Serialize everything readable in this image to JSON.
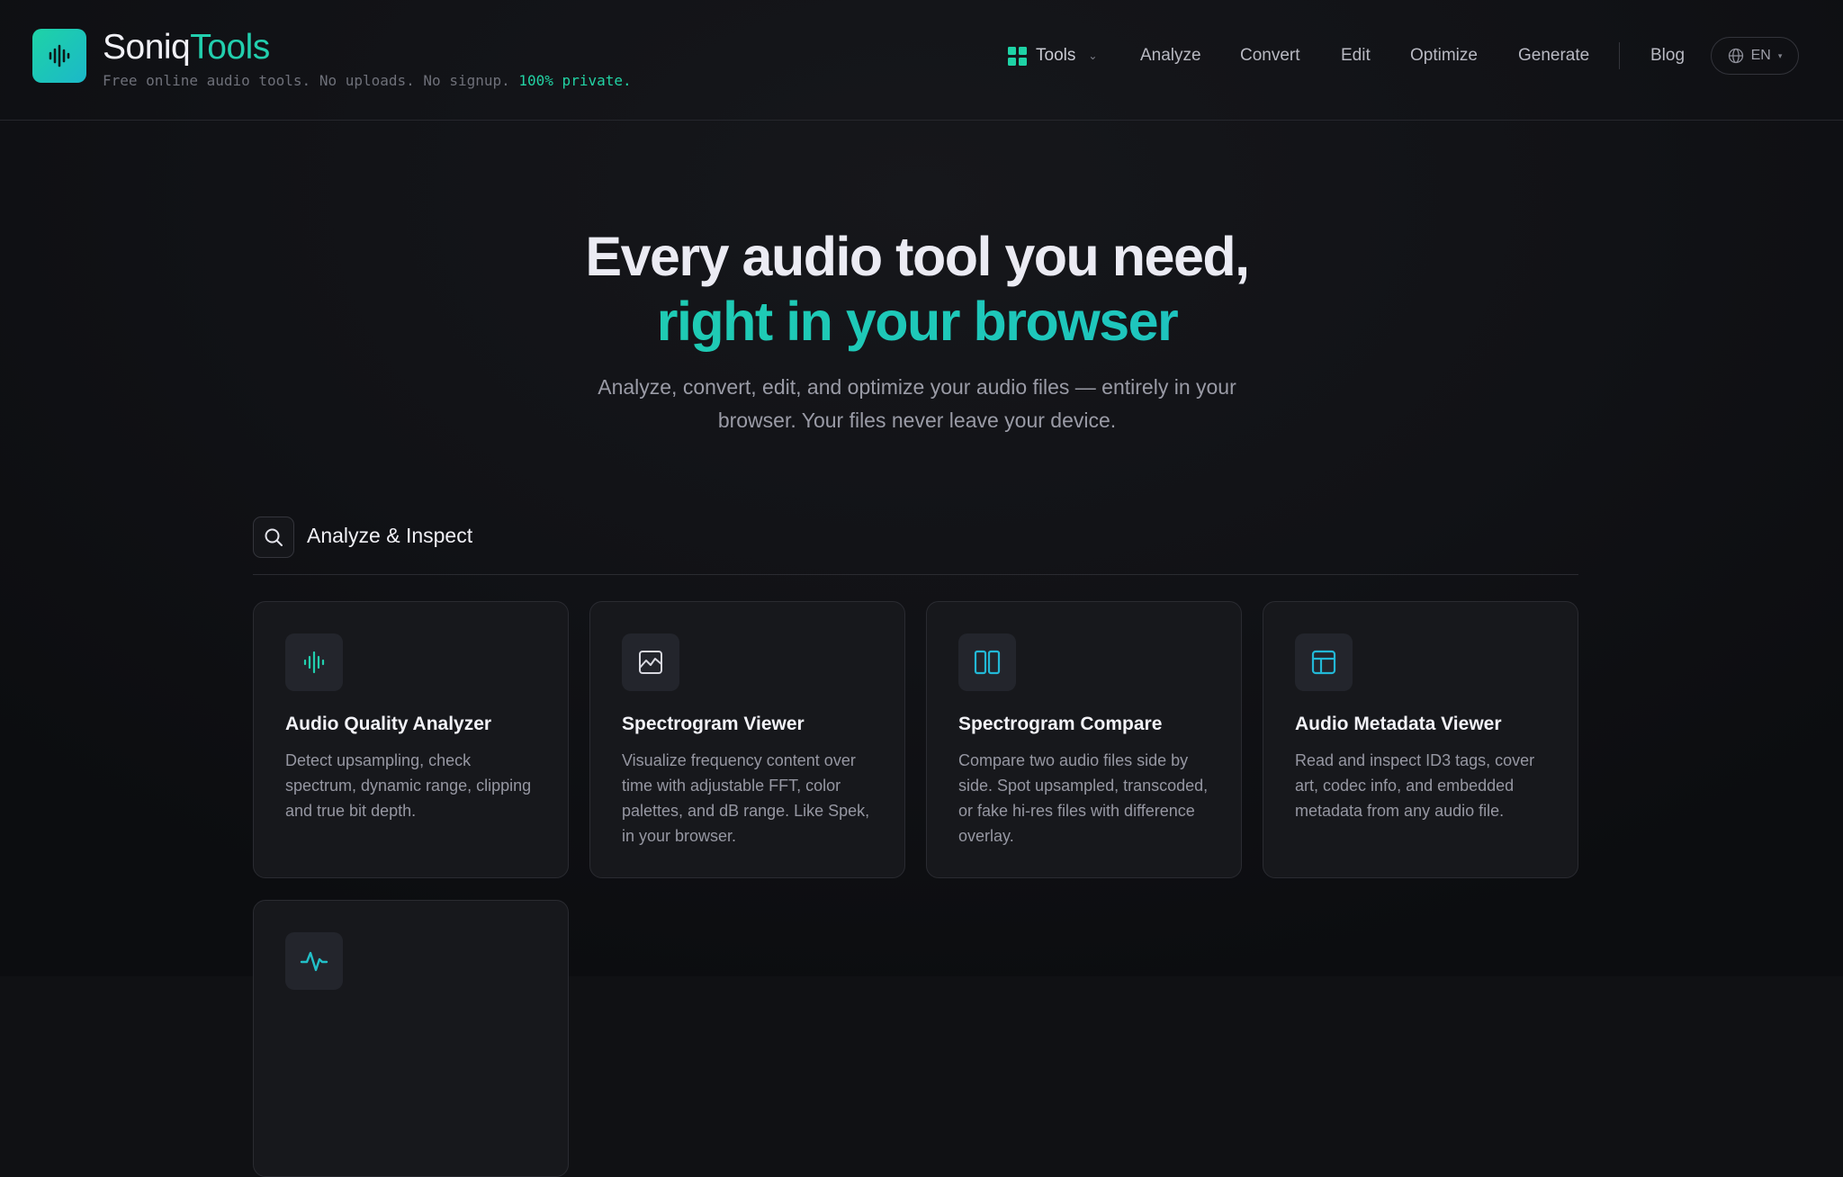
{
  "header": {
    "brand_part1": "Soniq",
    "brand_part2": "Tools",
    "tagline": "Free online audio tools. No uploads. No signup.",
    "tagline_highlight": "100% private.",
    "nav": {
      "tools": "Tools",
      "analyze": "Analyze",
      "convert": "Convert",
      "edit": "Edit",
      "optimize": "Optimize",
      "generate": "Generate",
      "blog": "Blog",
      "language": "EN"
    }
  },
  "hero": {
    "line1": "Every audio tool you need,",
    "line2": "right in your browser",
    "subtitle": "Analyze, convert, edit, and optimize your audio files — entirely in your browser. Your files never leave your device."
  },
  "section": {
    "title": "Analyze & Inspect",
    "icon": "search-icon"
  },
  "cards": [
    {
      "icon": "waveform-icon",
      "title": "Audio Quality Analyzer",
      "description": "Detect upsampling, check spectrum, dynamic range, clipping and true bit depth."
    },
    {
      "icon": "image-chart-icon",
      "title": "Spectrogram Viewer",
      "description": "Visualize frequency content over time with adjustable FFT, color palettes, and dB range. Like Spek, in your browser."
    },
    {
      "icon": "columns-icon",
      "title": "Spectrogram Compare",
      "description": "Compare two audio files side by side. Spot upsampled, transcoded, or fake hi-res files with difference overlay."
    },
    {
      "icon": "layout-icon",
      "title": "Audio Metadata Viewer",
      "description": "Read and inspect ID3 tags, cover art, codec info, and embedded metadata from any audio file."
    },
    {
      "icon": "activity-icon",
      "title": "",
      "description": ""
    }
  ],
  "colors": {
    "accent": "#22cfae",
    "accent_blue": "#1eb6d4",
    "background": "#101114",
    "card": "#17181c"
  }
}
